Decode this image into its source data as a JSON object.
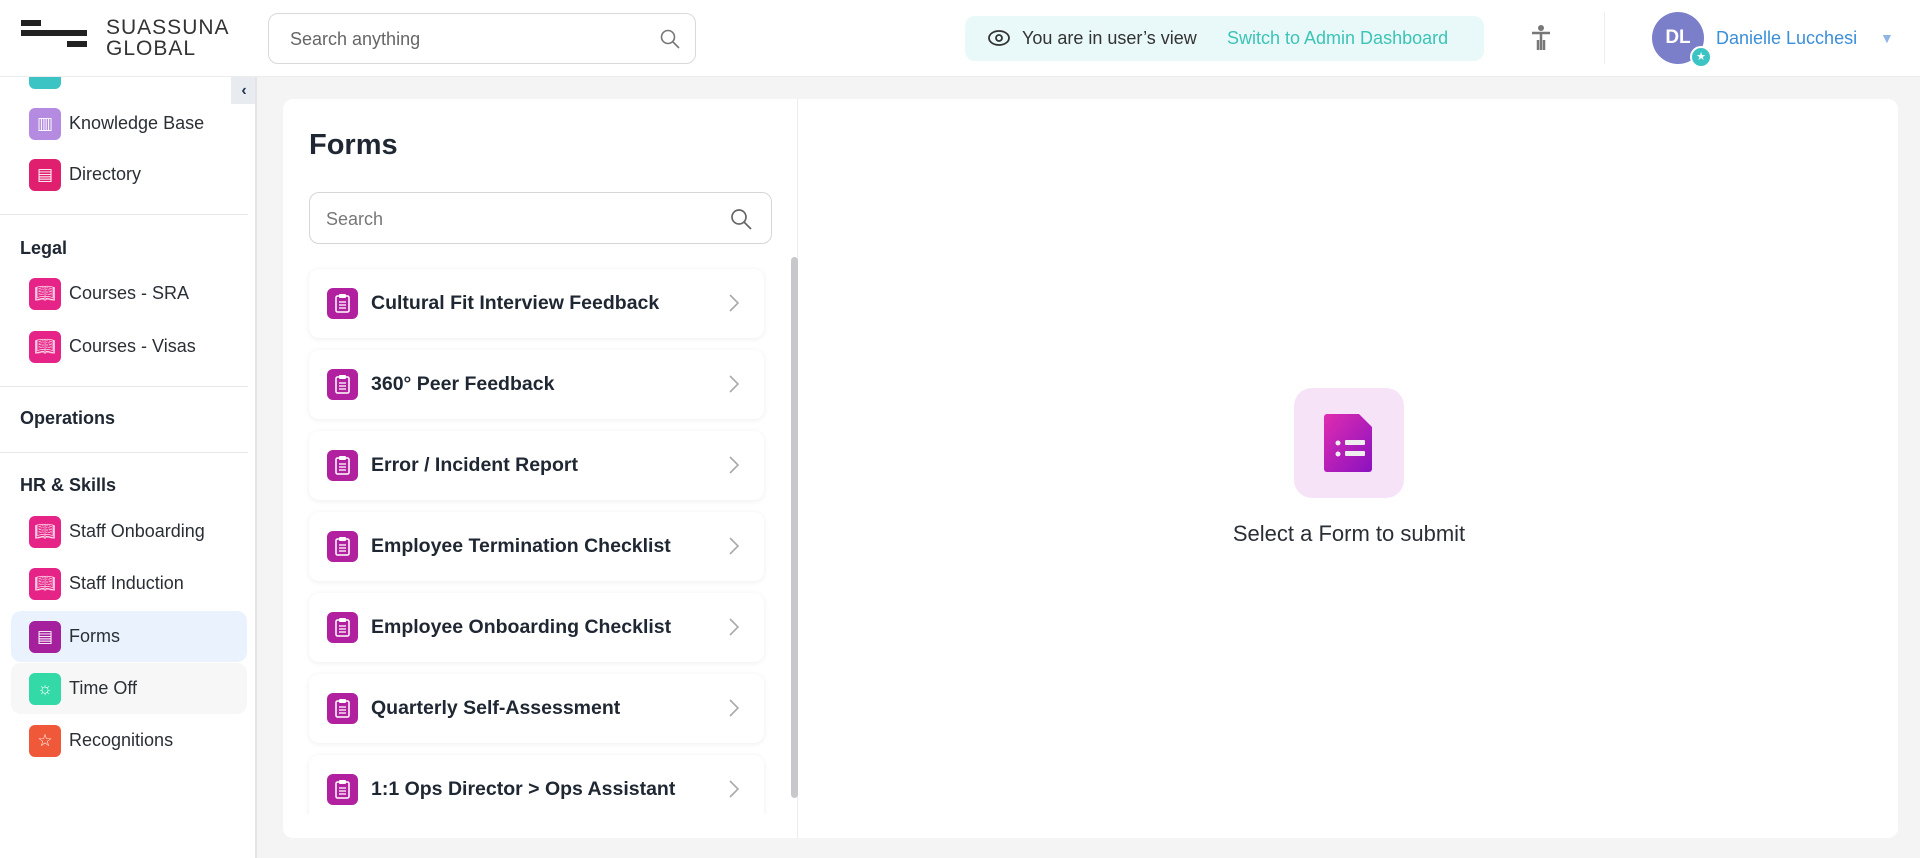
{
  "header": {
    "logo_text_line1": "SUASSUNA",
    "logo_text_line2": "GLOBAL",
    "search_placeholder": "Search anything",
    "view_notice": "You are in user’s view",
    "switch_link": "Switch to Admin Dashboard",
    "user_initials": "DL",
    "user_name": "Danielle Lucchesi"
  },
  "sidebar": {
    "items_top": [
      {
        "label": "Knowledge Base",
        "icon": "library-icon",
        "color": "#b48be0"
      },
      {
        "label": "Directory",
        "icon": "contact-book-icon",
        "color": "#e0206e"
      }
    ],
    "sections": [
      {
        "title": "Legal"
      },
      {
        "title": "Operations"
      },
      {
        "title": "HR & Skills"
      }
    ],
    "legal_items": [
      {
        "label": "Courses - SRA",
        "color": "#e62386"
      },
      {
        "label": "Courses - Visas",
        "color": "#e62386"
      }
    ],
    "hr_items": [
      {
        "label": "Staff Onboarding",
        "icon": "book-icon",
        "color": "#e62386"
      },
      {
        "label": "Staff Induction",
        "icon": "book-icon",
        "color": "#e62386"
      },
      {
        "label": "Forms",
        "icon": "clipboard-icon",
        "color": "#a5209d"
      },
      {
        "label": "Time Off",
        "icon": "sun-icon",
        "color": "#33d9a6"
      },
      {
        "label": "Recognitions",
        "icon": "star-icon",
        "color": "#f0583a"
      }
    ]
  },
  "forms": {
    "title": "Forms",
    "search_placeholder": "Search",
    "items": [
      "Cultural Fit Interview Feedback",
      "360° Peer Feedback",
      "Error / Incident Report",
      "Employee Termination Checklist",
      "Employee Onboarding Checklist",
      "Quarterly Self-Assessment",
      "1:1 Ops Director > Ops Assistant"
    ],
    "empty_message": "Select a Form to submit"
  }
}
